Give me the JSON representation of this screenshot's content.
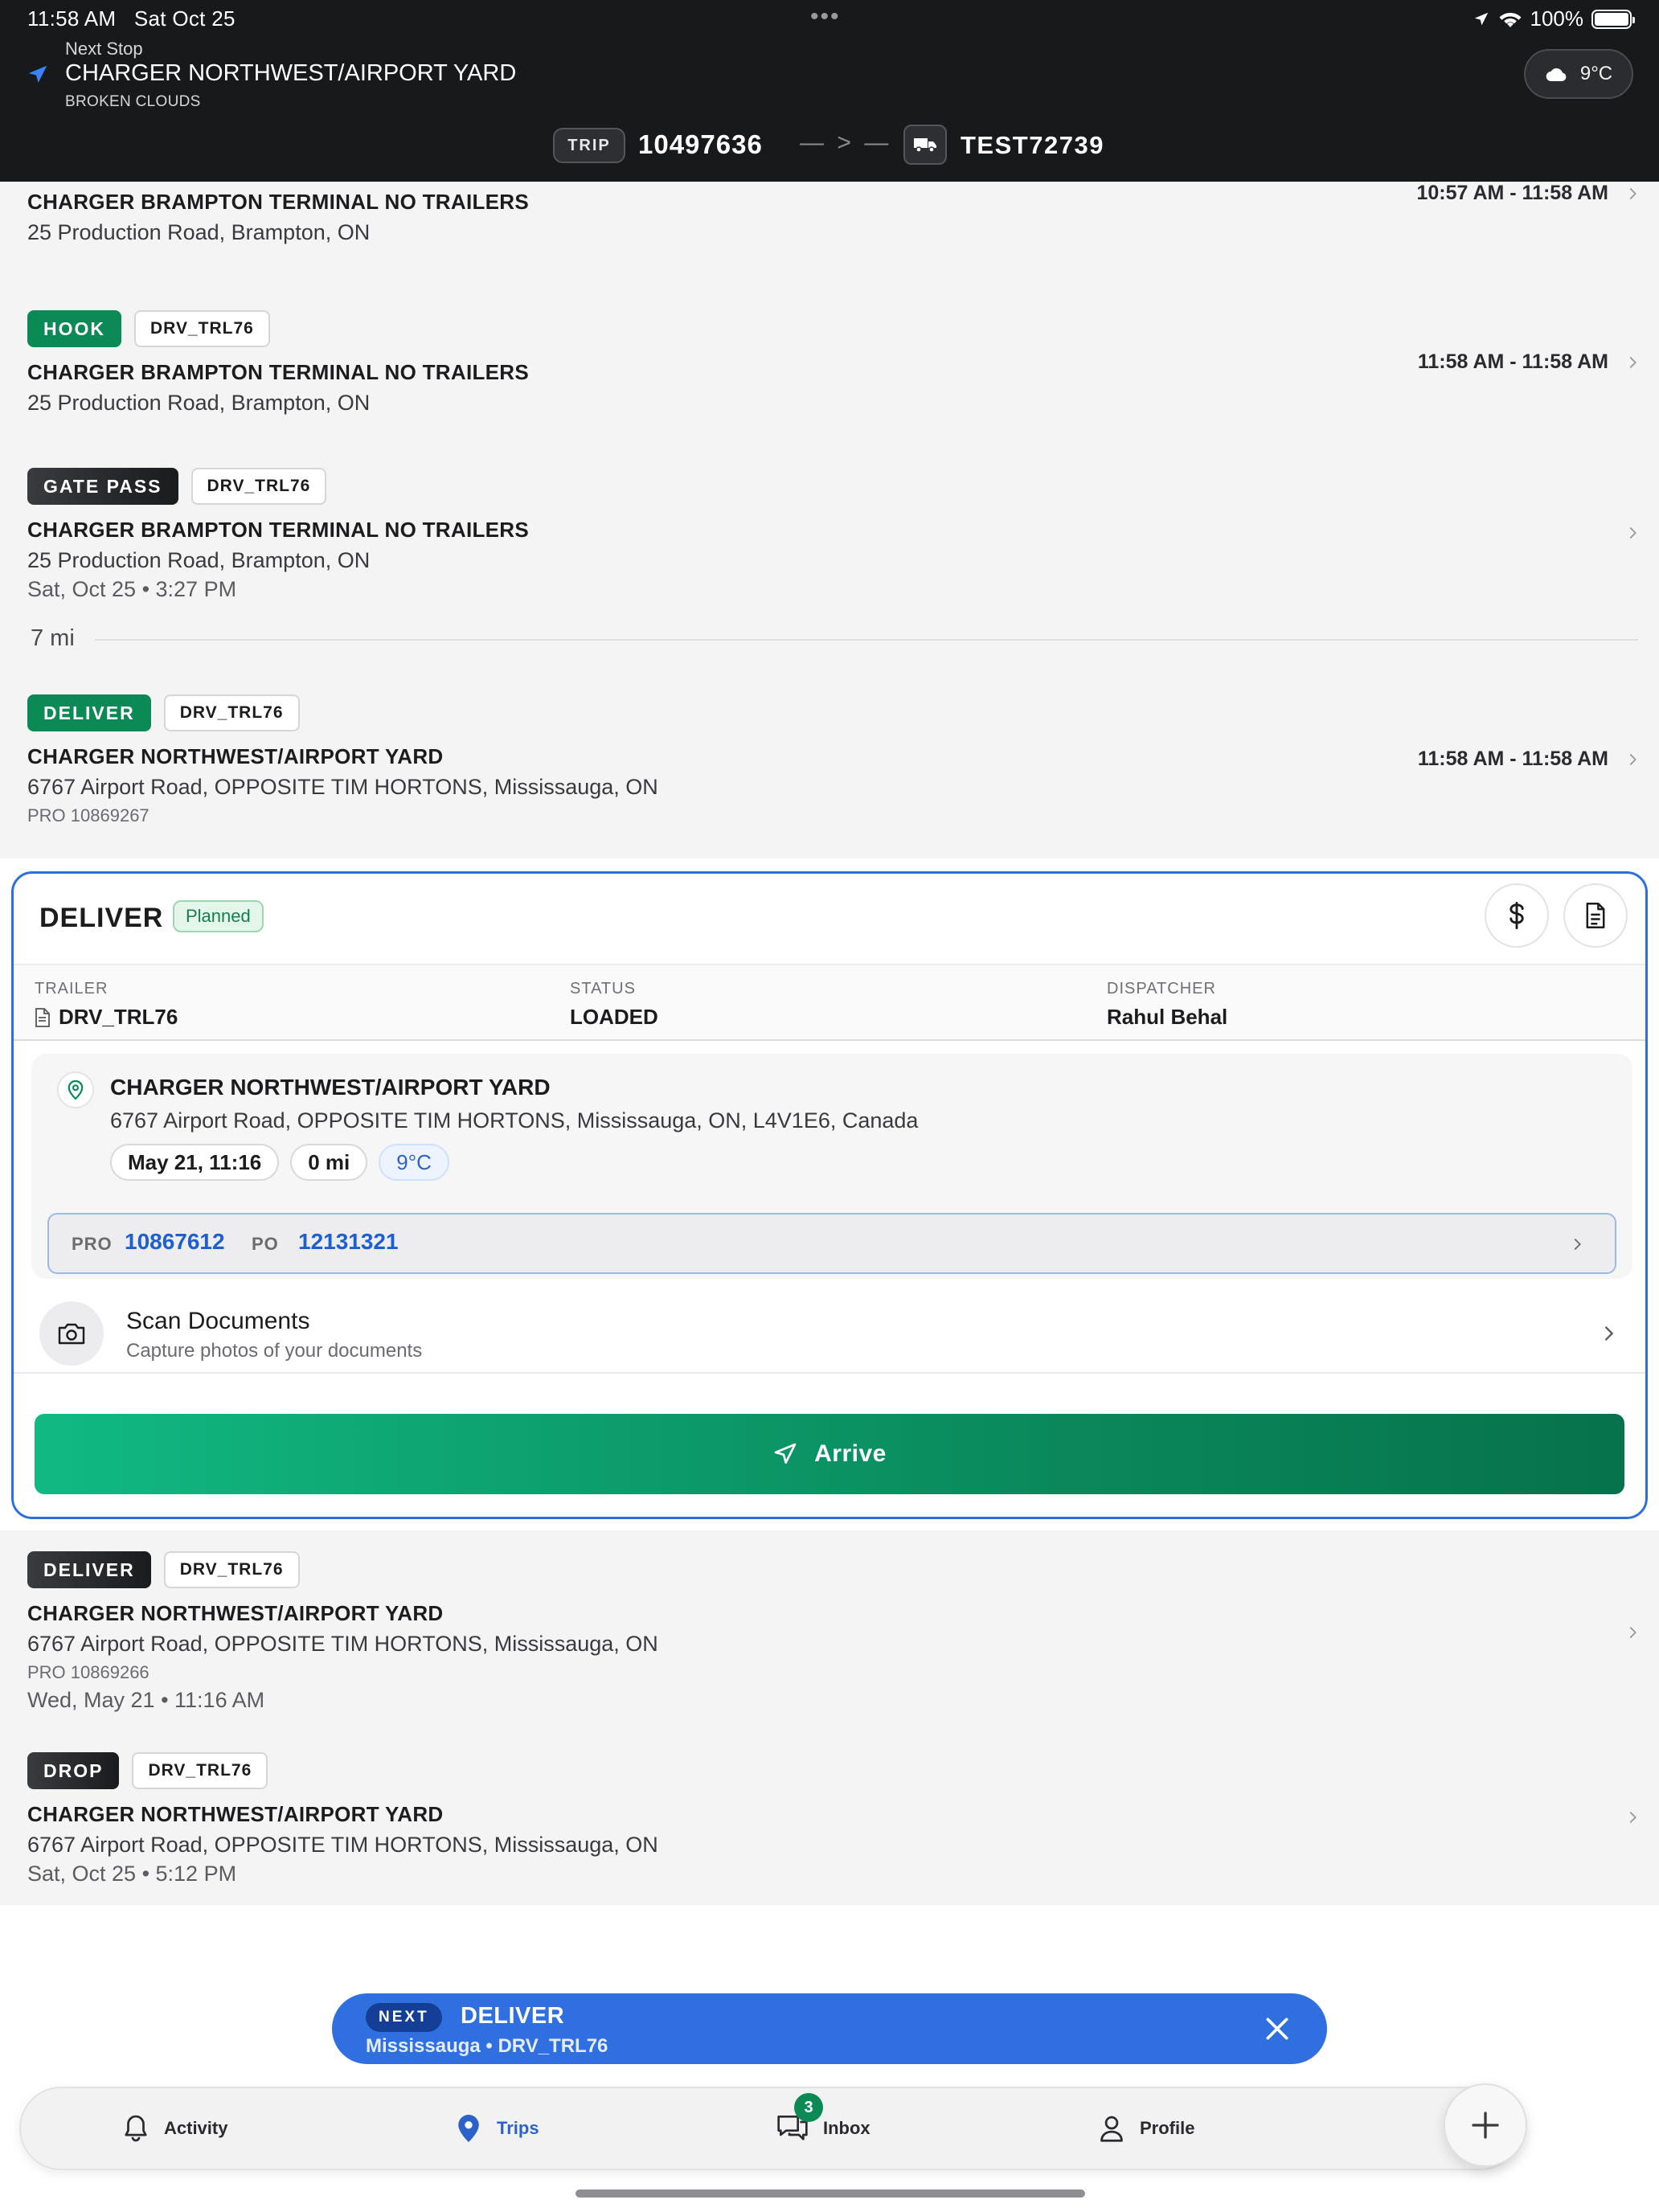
{
  "status_bar": {
    "time": "11:58 AM",
    "date": "Sat Oct 25",
    "battery": "100%"
  },
  "next_stop": {
    "label": "Next Stop",
    "name": "CHARGER NORTHWEST/AIRPORT YARD",
    "weather": "BROKEN CLOUDS",
    "temp": "9°C"
  },
  "trip": {
    "badge": "TRIP",
    "number": "10497636",
    "truck_id": "TEST72739"
  },
  "stops_top": [
    {
      "name": "CHARGER BRAMPTON TERMINAL NO TRAILERS",
      "address": "25 Production Road, Brampton, ON",
      "time": "10:57 AM - 11:58 AM"
    },
    {
      "type": "HOOK",
      "trailer": "DRV_TRL76",
      "name": "CHARGER BRAMPTON TERMINAL NO TRAILERS",
      "address": "25 Production Road, Brampton, ON",
      "time": "11:58 AM - 11:58 AM"
    },
    {
      "type": "GATE PASS",
      "trailer": "DRV_TRL76",
      "name": "CHARGER BRAMPTON TERMINAL NO TRAILERS",
      "address": "25 Production Road, Brampton, ON",
      "date": "Sat, Oct 25 • 3:27 PM"
    },
    {
      "type": "DELIVER",
      "trailer": "DRV_TRL76",
      "name": "CHARGER NORTHWEST/AIRPORT YARD",
      "address": "6767 Airport Road, OPPOSITE TIM HORTONS, Mississauga, ON",
      "pro": "PRO 10869267",
      "time": "11:58 AM - 11:58 AM"
    }
  ],
  "distance": "7 mi",
  "card": {
    "title": "DELIVER",
    "status_tag": "Planned",
    "trailer_label": "TRAILER",
    "trailer_value": "DRV_TRL76",
    "status_label": "STATUS",
    "status_value": "LOADED",
    "dispatcher_label": "DISPATCHER",
    "dispatcher_value": "Rahul Behal",
    "location_name": "CHARGER NORTHWEST/AIRPORT YARD",
    "location_address": "6767 Airport Road, OPPOSITE TIM HORTONS, Mississauga, ON, L4V1E6, Canada",
    "chip_date": "May 21, 11:16",
    "chip_distance": "0 mi",
    "chip_temp": "9°C",
    "pro_label": "PRO",
    "pro_value": "10867612",
    "po_label": "PO",
    "po_value": "12131321",
    "scan_title": "Scan Documents",
    "scan_subtitle": "Capture photos of your documents",
    "arrive_label": "Arrive"
  },
  "stops_bottom": [
    {
      "type": "DELIVER",
      "trailer": "DRV_TRL76",
      "name": "CHARGER NORTHWEST/AIRPORT YARD",
      "address": "6767 Airport Road, OPPOSITE TIM HORTONS, Mississauga, ON",
      "pro": "PRO 10869266",
      "date": "Wed, May 21 • 11:16 AM"
    },
    {
      "type": "DROP",
      "trailer": "DRV_TRL76",
      "name": "CHARGER NORTHWEST/AIRPORT YARD",
      "address": "6767 Airport Road, OPPOSITE TIM HORTONS, Mississauga, ON",
      "date": "Sat, Oct 25 • 5:12 PM"
    }
  ],
  "next_banner": {
    "pill": "NEXT",
    "title": "DELIVER",
    "subtitle": "Mississauga • DRV_TRL76"
  },
  "tabs": {
    "activity": "Activity",
    "trips": "Trips",
    "inbox": "Inbox",
    "inbox_count": "3",
    "profile": "Profile"
  },
  "colors": {
    "accent_blue": "#2f6fe0",
    "green": "#0b8a55",
    "header_bg": "#18191b"
  }
}
